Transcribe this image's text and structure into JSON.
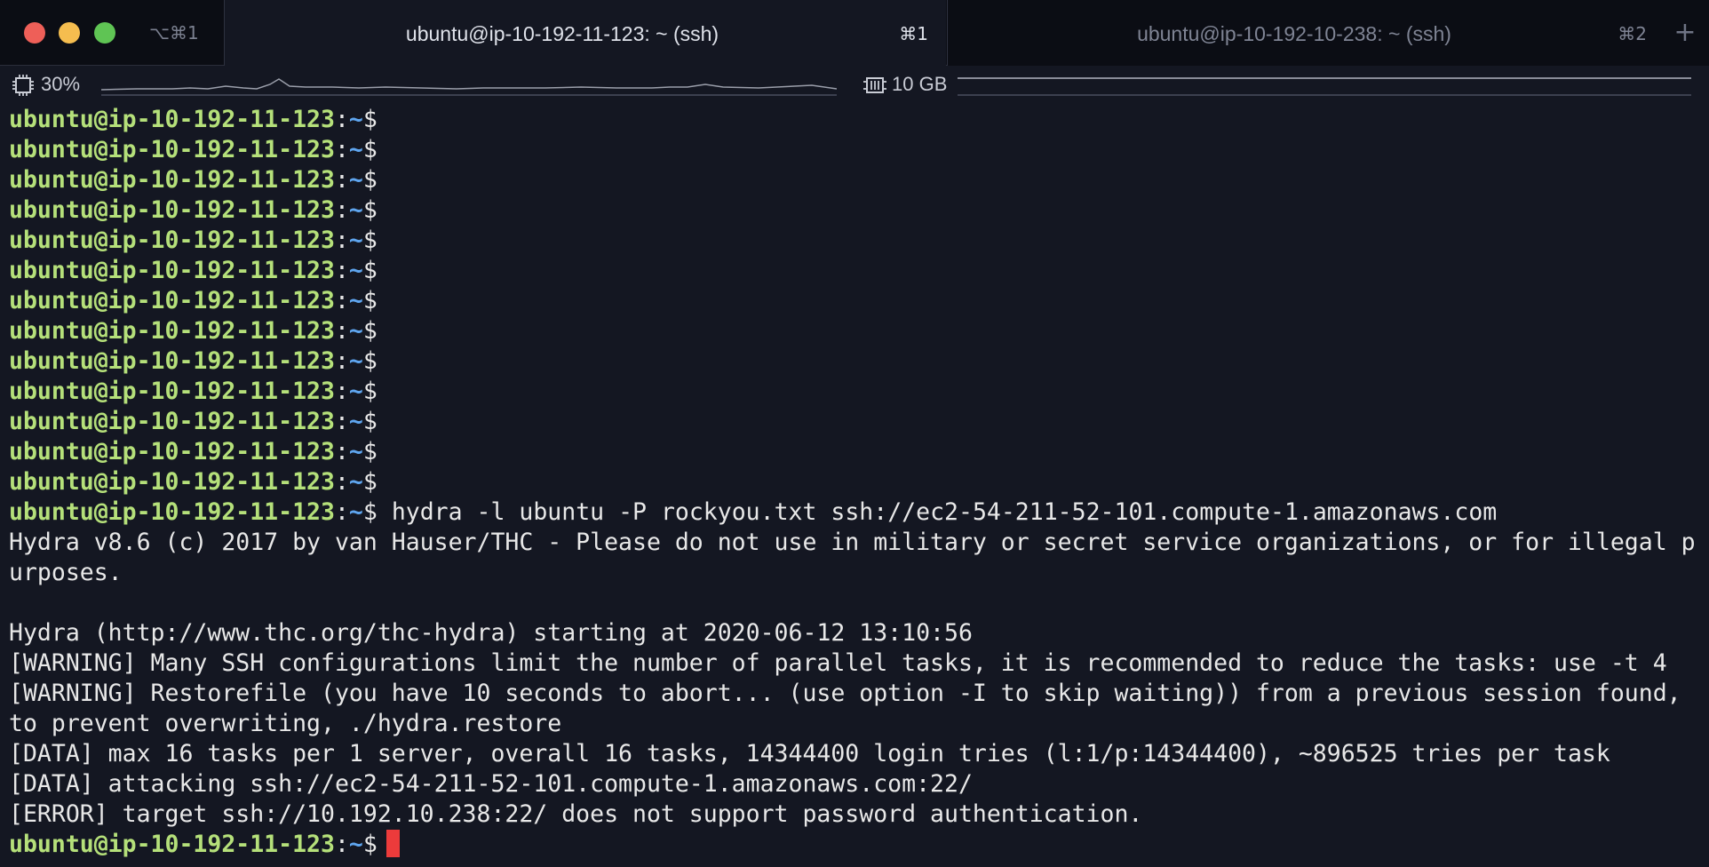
{
  "window": {
    "traffic_lights": {
      "close": "#ee5f58",
      "minimize": "#f5bd4f",
      "maximize": "#5fc454"
    },
    "all_tabs_shortcut": "⌥⌘1"
  },
  "tabs": [
    {
      "title": "ubuntu@ip-10-192-11-123: ~ (ssh)",
      "shortcut": "⌘1",
      "active": true
    },
    {
      "title": "ubuntu@ip-10-192-10-238: ~ (ssh)",
      "shortcut": "⌘2",
      "active": false
    }
  ],
  "new_tab_label": "+",
  "status": {
    "cpu_icon": "cpu-icon",
    "cpu": "30%",
    "memory_icon": "memory-icon",
    "memory": "10 GB"
  },
  "colors": {
    "background": "#141722",
    "prompt_user": "#b5e07a",
    "prompt_path": "#5fa6f0",
    "cursor": "#ec3b3b"
  },
  "prompt": {
    "user_host": "ubuntu@ip-10-192-11-123",
    "colon": ":",
    "path": "~",
    "symbol": "$"
  },
  "terminal": {
    "command": " hydra -l ubuntu -P rockyou.txt ssh://ec2-54-211-52-101.compute-1.amazonaws.com",
    "output": [
      "Hydra v8.6 (c) 2017 by van Hauser/THC - Please do not use in military or secret service organizations, or for illegal p",
      "urposes.",
      "",
      "Hydra (http://www.thc.org/thc-hydra) starting at 2020-06-12 13:10:56",
      "[WARNING] Many SSH configurations limit the number of parallel tasks, it is recommended to reduce the tasks: use -t 4",
      "[WARNING] Restorefile (you have 10 seconds to abort... (use option -I to skip waiting)) from a previous session found,",
      "to prevent overwriting, ./hydra.restore",
      "[DATA] max 16 tasks per 1 server, overall 16 tasks, 14344400 login tries (l:1/p:14344400), ~896525 tries per task",
      "[DATA] attacking ssh://ec2-54-211-52-101.compute-1.amazonaws.com:22/",
      "[ERROR] target ssh://10.192.10.238:22/ does not support password authentication."
    ]
  }
}
